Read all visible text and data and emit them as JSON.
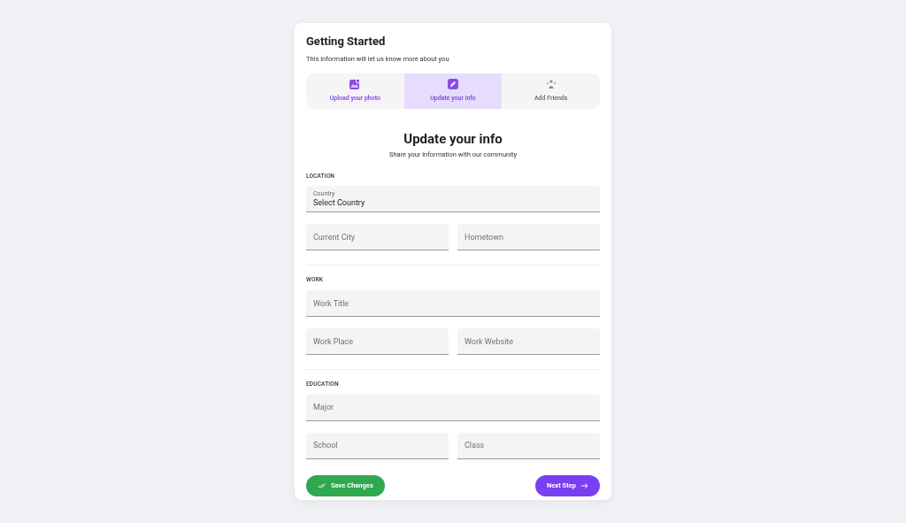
{
  "header": {
    "title": "Getting Started",
    "subtitle": "This information will let us know more about you"
  },
  "steps": [
    {
      "label": "Upload your photo",
      "kind": "photo",
      "selected": false,
      "done": true
    },
    {
      "label": "Update your info",
      "kind": "edit",
      "selected": true,
      "done": false
    },
    {
      "label": "Add Friends",
      "kind": "friends",
      "selected": false,
      "done": false
    }
  ],
  "form": {
    "title": "Update your info",
    "subtitle": "Share your information with our community",
    "sections": [
      {
        "title": "LOCATION",
        "rows": [
          [
            {
              "label": "Country",
              "value": "Select Country"
            }
          ],
          [
            {
              "placeholder": "Current City"
            },
            {
              "placeholder": "Hometown"
            }
          ]
        ]
      },
      {
        "title": "WORK",
        "rows": [
          [
            {
              "placeholder": "Work Title"
            }
          ],
          [
            {
              "placeholder": "Work Place"
            },
            {
              "placeholder": "Work Website"
            }
          ]
        ]
      },
      {
        "title": "EDUCATION",
        "rows": [
          [
            {
              "placeholder": "Major"
            }
          ],
          [
            {
              "placeholder": "School"
            },
            {
              "placeholder": "Class"
            }
          ]
        ]
      }
    ]
  },
  "buttons": {
    "save": "Save Changes",
    "next": "Next Step"
  }
}
